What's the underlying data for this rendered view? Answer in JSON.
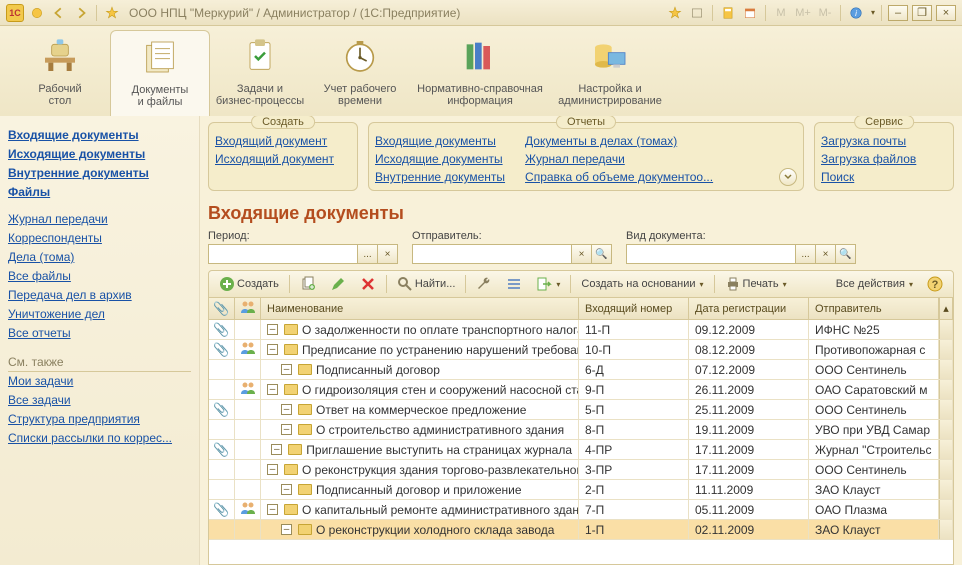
{
  "title": "ООО НПЦ \"Меркурий\" / Администратор /  (1С:Предприятие)",
  "nav": [
    {
      "label": "Рабочий\nстол"
    },
    {
      "label": "Документы\nи файлы"
    },
    {
      "label": "Задачи и\nбизнес-процессы"
    },
    {
      "label": "Учет рабочего\nвремени"
    },
    {
      "label": "Нормативно-справочная\nинформация"
    },
    {
      "label": "Настройка и\nадминистрирование"
    }
  ],
  "sidebar": {
    "bold": [
      "Входящие документы",
      "Исходящие документы",
      "Внутренние документы",
      "Файлы"
    ],
    "links": [
      "Журнал передачи",
      "Корреспонденты",
      "Дела (тома)",
      "Все файлы",
      "Передача дел в архив",
      "Уничтожение дел",
      "Все отчеты"
    ],
    "see_also_title": "См. также",
    "see_also": [
      "Мои задачи",
      "Все задачи",
      "Структура предприятия",
      "Списки рассылки по коррес..."
    ]
  },
  "panels": {
    "create": {
      "title": "Создать",
      "links": [
        "Входящий документ",
        "Исходящий документ"
      ]
    },
    "reports": {
      "title": "Отчеты",
      "cols": [
        [
          "Входящие документы",
          "Исходящие документы",
          "Внутренние документы"
        ],
        [
          "Документы в делах (томах)",
          "Журнал передачи",
          "Справка об объеме документоо..."
        ]
      ]
    },
    "service": {
      "title": "Сервис",
      "links": [
        "Загрузка почты",
        "Загрузка файлов",
        "Поиск"
      ]
    }
  },
  "page_title": "Входящие документы",
  "filters": {
    "period": {
      "label": "Период:",
      "value": ""
    },
    "sender": {
      "label": "Отправитель:",
      "value": ""
    },
    "kind": {
      "label": "Вид документа:",
      "value": ""
    }
  },
  "table_toolbar": {
    "create": "Создать",
    "find": "Найти...",
    "create_based": "Создать на основании",
    "print": "Печать",
    "all_actions": "Все действия"
  },
  "grid": {
    "headers": {
      "name": "Наименование",
      "num": "Входящий номер",
      "date": "Дата регистрации",
      "sender": "Отправитель"
    },
    "rows": [
      {
        "clip": true,
        "users": false,
        "name": "О задолженности по оплате транспортного налога",
        "num": "11-П",
        "date": "09.12.2009",
        "sender": "ИФНС №25",
        "indent": 1
      },
      {
        "clip": true,
        "users": true,
        "name": "Предписание по устранению нарушений требований п...",
        "num": "10-П",
        "date": "08.12.2009",
        "sender": "Противопожарная с",
        "indent": 1
      },
      {
        "clip": false,
        "users": false,
        "name": "Подписанный договор",
        "num": "6-Д",
        "date": "07.12.2009",
        "sender": "ООО Сентинель",
        "indent": 1
      },
      {
        "clip": false,
        "users": true,
        "name": "О гидроизоляция стен и сооружений насосной станции",
        "num": "9-П",
        "date": "26.11.2009",
        "sender": "ОАО Саратовский м",
        "indent": 1
      },
      {
        "clip": true,
        "users": false,
        "name": "Ответ на коммерческое предложение",
        "num": "5-П",
        "date": "25.11.2009",
        "sender": "ООО Сентинель",
        "indent": 1
      },
      {
        "clip": false,
        "users": false,
        "name": "О строительство административного здания",
        "num": "8-П",
        "date": "19.11.2009",
        "sender": "УВО при УВД Самар",
        "indent": 1
      },
      {
        "clip": true,
        "users": false,
        "name": "Приглашение выступить на страницах журнала",
        "num": "4-ПР",
        "date": "17.11.2009",
        "sender": "Журнал \"Строительс",
        "indent": 1
      },
      {
        "clip": false,
        "users": false,
        "name": "О реконструкция здания торгово-развлекательного ц...",
        "num": "3-ПР",
        "date": "17.11.2009",
        "sender": "ООО Сентинель",
        "indent": 1
      },
      {
        "clip": false,
        "users": false,
        "name": "Подписанный договор и приложение",
        "num": "2-П",
        "date": "11.11.2009",
        "sender": "ЗАО Клауст",
        "indent": 1
      },
      {
        "clip": true,
        "users": true,
        "name": "О капитальный ремонте административного здания",
        "num": "7-П",
        "date": "05.11.2009",
        "sender": "ОАО Плазма",
        "indent": 1
      },
      {
        "clip": false,
        "users": false,
        "name": "О реконструкции холодного склада завода",
        "num": "1-П",
        "date": "02.11.2009",
        "sender": "ЗАО Клауст",
        "indent": 1,
        "selected": true
      }
    ]
  }
}
